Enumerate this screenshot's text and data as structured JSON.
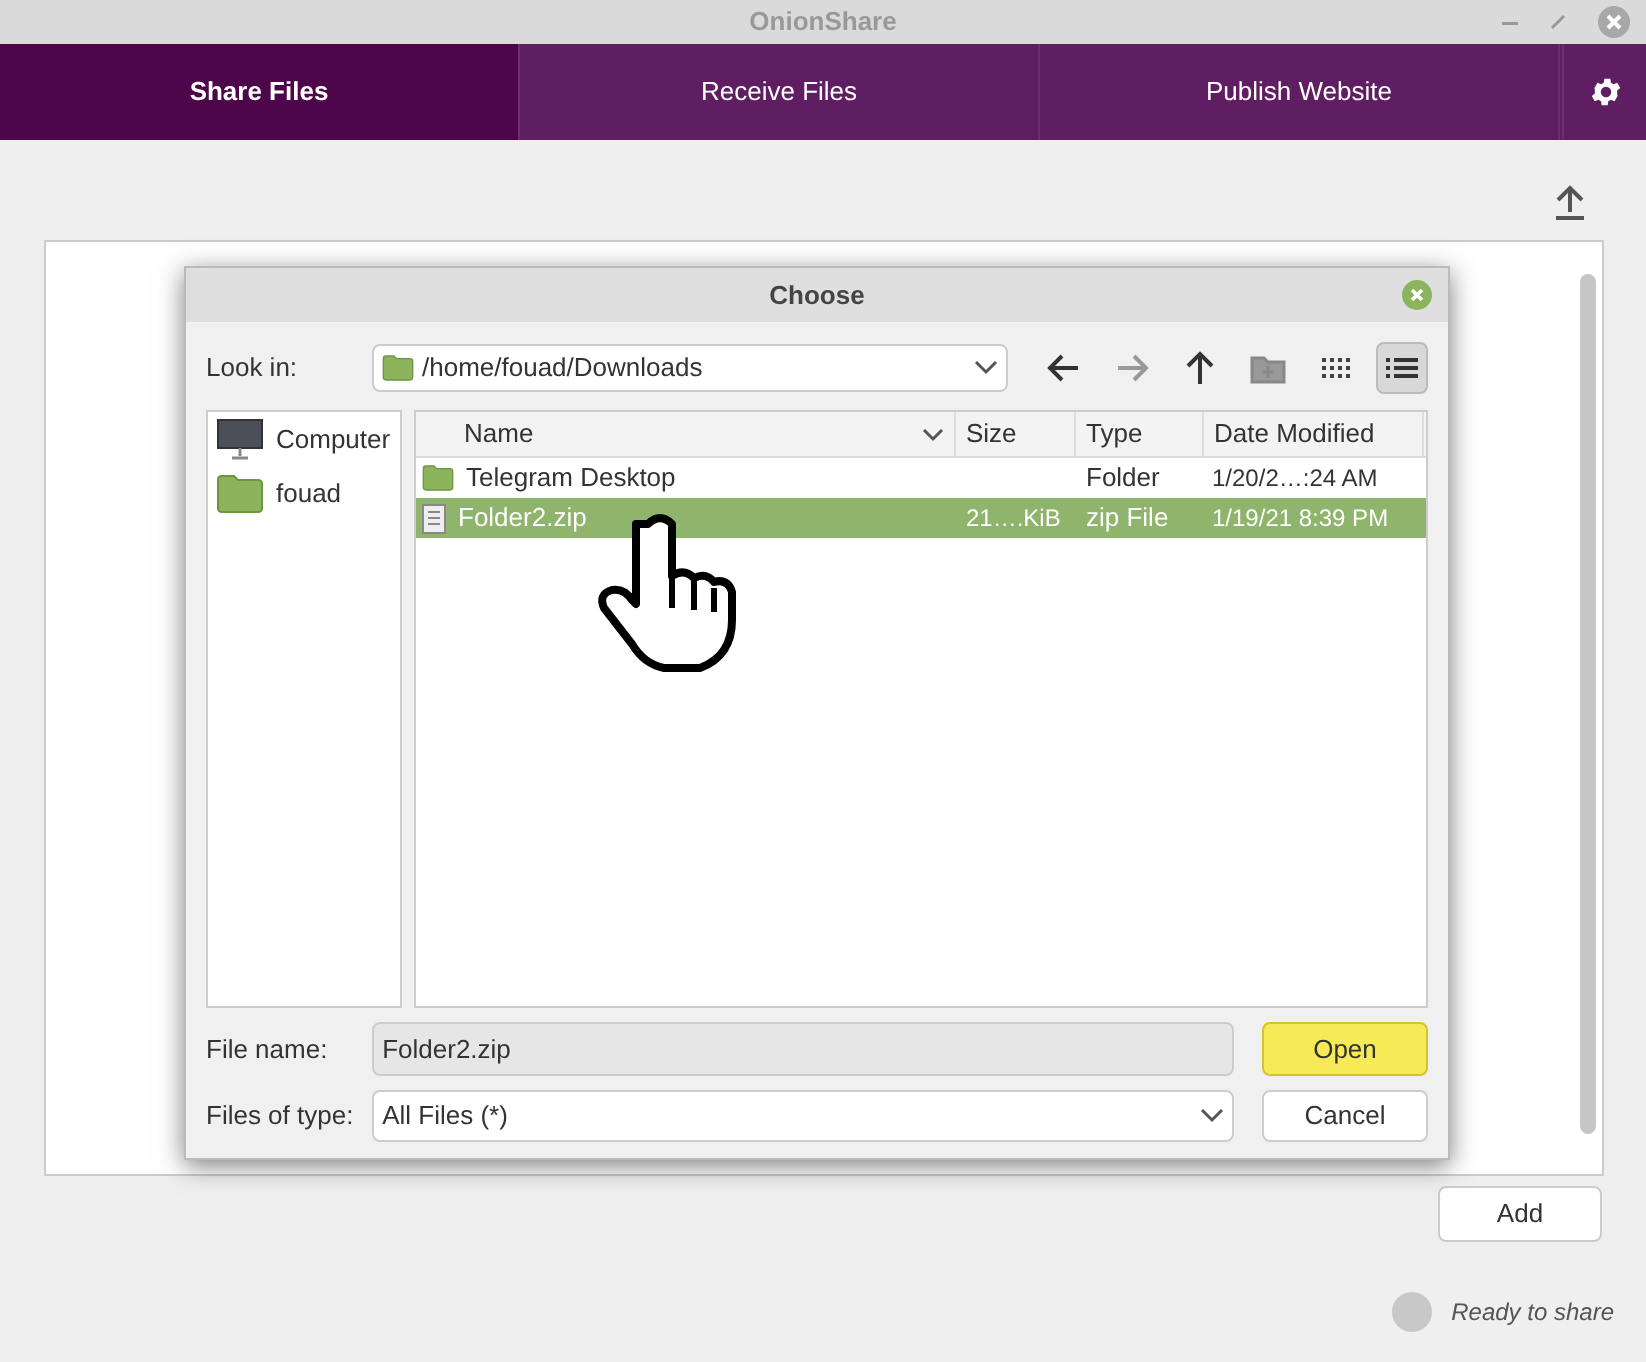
{
  "window": {
    "title": "OnionShare"
  },
  "tabs": [
    {
      "label": "Share Files",
      "selected": true
    },
    {
      "label": "Receive Files",
      "selected": false
    },
    {
      "label": "Publish Website",
      "selected": false
    }
  ],
  "dialog": {
    "title": "Choose",
    "look_in_label": "Look in:",
    "look_in_path": "/home/fouad/Downloads",
    "places": [
      {
        "label": "Computer",
        "kind": "computer"
      },
      {
        "label": "fouad",
        "kind": "folder"
      }
    ],
    "columns": [
      "Name",
      "Size",
      "Type",
      "Date Modified"
    ],
    "files": [
      {
        "kind": "folder",
        "name": "Telegram Desktop",
        "type": "Folder",
        "modified": "1/20/2…:24 AM",
        "selected": false
      },
      {
        "kind": "file",
        "name": "Folder2.zip",
        "size": "21….KiB",
        "type": "zip File",
        "modified": "1/19/21 8:39 PM",
        "selected": true
      }
    ],
    "file_name_label": "File name:",
    "file_name": "Folder2.zip",
    "file_type_label": "Files of type:",
    "file_type": "All Files (*)",
    "buttons": [
      "Open",
      "Cancel"
    ]
  },
  "add_button": "Add",
  "status": "Ready to share"
}
